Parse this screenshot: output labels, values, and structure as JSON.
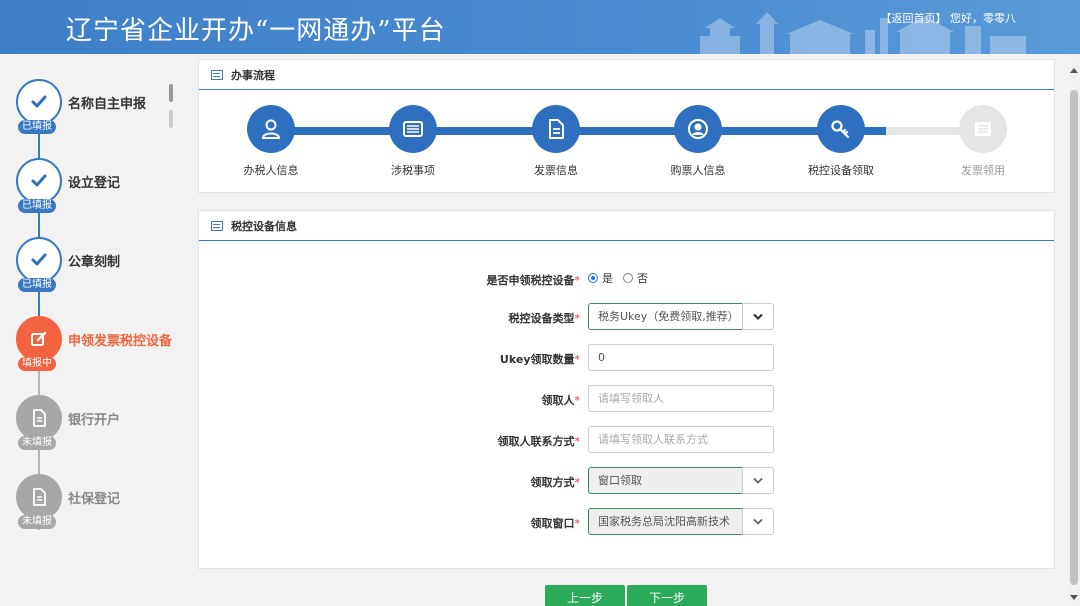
{
  "header": {
    "title": "辽宁省企业开办“一网通办”平台",
    "home_link": "【返回首页】",
    "greeting": "您好，零零八"
  },
  "sidebar": {
    "steps": [
      {
        "name": "名称自主申报",
        "status": "已填报",
        "state": "done",
        "icon": "check-icon"
      },
      {
        "name": "设立登记",
        "status": "已填报",
        "state": "done",
        "icon": "check-icon"
      },
      {
        "name": "公章刻制",
        "status": "已填报",
        "state": "done",
        "icon": "check-icon"
      },
      {
        "name": "申领发票税控设备",
        "status": "填报中",
        "state": "active",
        "icon": "edit-icon"
      },
      {
        "name": "银行开户",
        "status": "未填报",
        "state": "pending",
        "icon": "document-icon"
      },
      {
        "name": "社保登记",
        "status": "未填报",
        "state": "pending",
        "icon": "document-icon"
      }
    ]
  },
  "process_panel": {
    "title": "办事流程",
    "steps": [
      {
        "label": "办税人信息",
        "icon": "person-icon",
        "done": true
      },
      {
        "label": "涉税事项",
        "icon": "list-card-icon",
        "done": true
      },
      {
        "label": "发票信息",
        "icon": "document-icon",
        "done": true
      },
      {
        "label": "购票人信息",
        "icon": "user-circle-icon",
        "done": true
      },
      {
        "label": "税控设备领取",
        "icon": "key-icon",
        "done": true
      },
      {
        "label": "发票领用",
        "icon": "list-icon",
        "done": false
      }
    ]
  },
  "device_panel": {
    "title": "税控设备信息",
    "apply": {
      "label": "是否申领税控设备",
      "req": "*",
      "options": [
        "是",
        "否"
      ],
      "selected": "是"
    },
    "device_type": {
      "label": "税控设备类型",
      "req": "*",
      "value": "税务Ukey（免费领取,推荐）"
    },
    "ukey_count": {
      "label": "Ukey领取数量",
      "req": "*",
      "value": "0"
    },
    "recipient": {
      "label": "领取人",
      "req": "*",
      "placeholder": "请填写领取人"
    },
    "contact": {
      "label": "领取人联系方式",
      "req": "*",
      "placeholder": "请填写领取人联系方式"
    },
    "method": {
      "label": "领取方式",
      "req": "*",
      "value": "窗口领取"
    },
    "window": {
      "label": "领取窗口",
      "req": "*",
      "value": "国家税务总局沈阳高新技术"
    }
  },
  "buttons": {
    "prev": "上一步",
    "next": "下一步"
  },
  "colors": {
    "primary": "#2f6fc0",
    "active": "#f2643f",
    "pending": "#a7a7a7",
    "button": "#2bab57"
  }
}
